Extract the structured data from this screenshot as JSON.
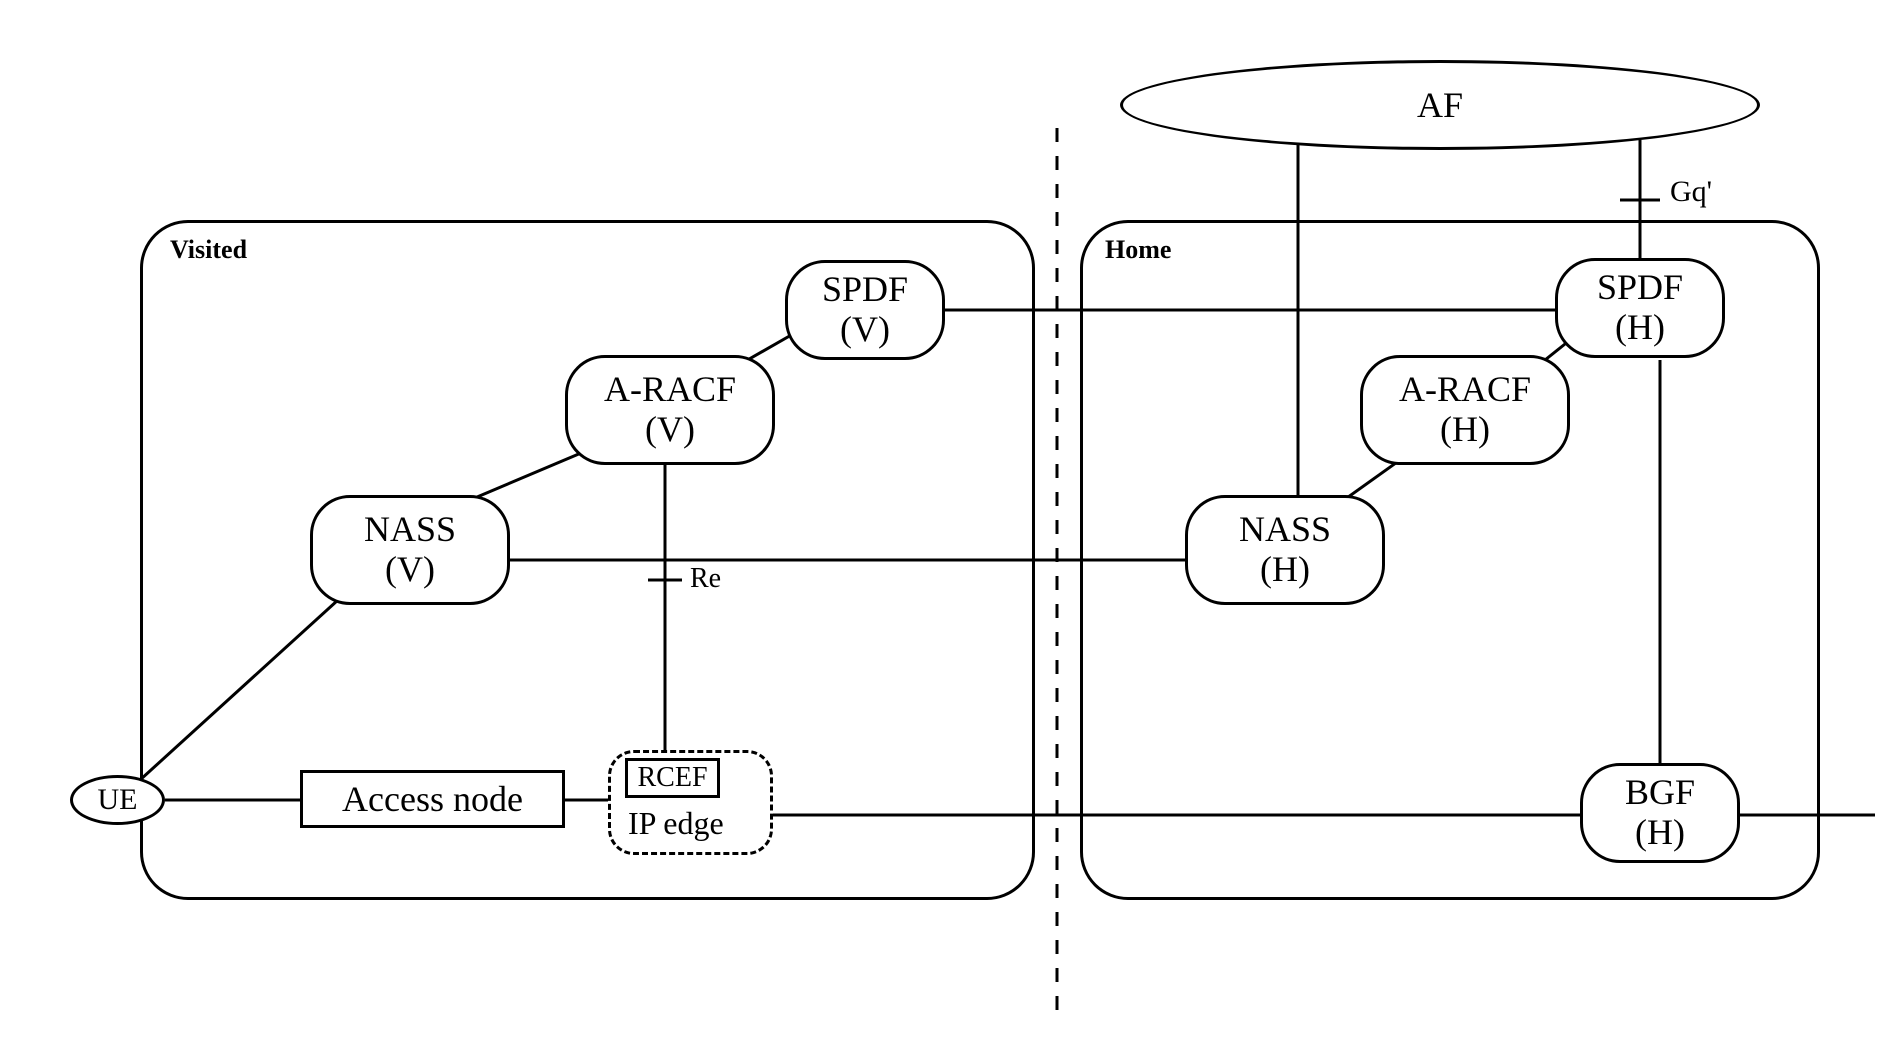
{
  "af": {
    "label": "AF"
  },
  "gq_label": "Gq'",
  "visited": {
    "title": "Visited",
    "spdf": {
      "l1": "SPDF",
      "l2": "(V)"
    },
    "aracf": {
      "l1": "A-RACF",
      "l2": "(V)"
    },
    "nass": {
      "l1": "NASS",
      "l2": "(V)"
    },
    "re_label": "Re",
    "rcef_label": "RCEF",
    "ipedge_label": "IP edge"
  },
  "home": {
    "title": "Home",
    "spdf": {
      "l1": "SPDF",
      "l2": "(H)"
    },
    "aracf": {
      "l1": "A-RACF",
      "l2": "(H)"
    },
    "nass": {
      "l1": "NASS",
      "l2": "(H)"
    },
    "bgf": {
      "l1": "BGF",
      "l2": "(H)"
    }
  },
  "ue_label": "UE",
  "access_node_label": "Access node"
}
